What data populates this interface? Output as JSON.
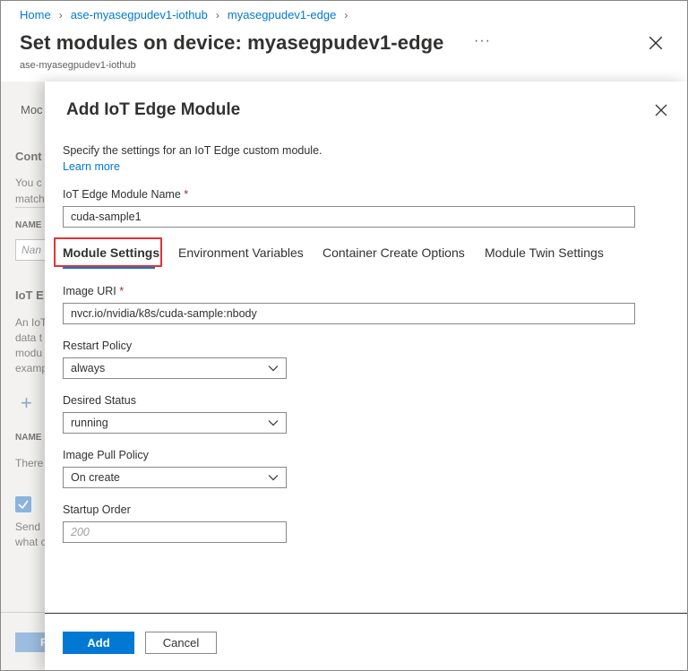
{
  "breadcrumb": {
    "items": [
      "Home",
      "ase-myasegpudev1-iothub",
      "myasegpudev1-edge"
    ]
  },
  "page": {
    "title": "Set modules on device: myasegpudev1-edge",
    "subtitle": "ase-myasegpudev1-iothub",
    "more": "···"
  },
  "background_blade": {
    "tab": "Moc",
    "section1": "Cont",
    "line1": "You c",
    "line2": "match",
    "name_header": "NAME",
    "name_placeholder": "Nan",
    "section2": "IoT E",
    "desc1": "An IoT",
    "desc2": "data t",
    "desc3": "modu",
    "desc4": "examp",
    "plus": "+",
    "name_header2": "NAME",
    "there": "There",
    "send1": "Send",
    "send2": "what c",
    "btn": "R"
  },
  "panel": {
    "title": "Add IoT Edge Module",
    "intro": "Specify the settings for an IoT Edge custom module.",
    "learn_more": "Learn more",
    "module_name_label": "IoT Edge Module Name",
    "module_name_value": "cuda-sample1",
    "required_mark": "*",
    "tabs": [
      {
        "label": "Module Settings",
        "active": true
      },
      {
        "label": "Environment Variables",
        "active": false
      },
      {
        "label": "Container Create Options",
        "active": false
      },
      {
        "label": "Module Twin Settings",
        "active": false
      }
    ],
    "image_uri_label": "Image URI",
    "image_uri_value": "nvcr.io/nvidia/k8s/cuda-sample:nbody",
    "restart_policy_label": "Restart Policy",
    "restart_policy_value": "always",
    "desired_status_label": "Desired Status",
    "desired_status_value": "running",
    "image_pull_policy_label": "Image Pull Policy",
    "image_pull_policy_value": "On create",
    "startup_order_label": "Startup Order",
    "startup_order_placeholder": "200",
    "add_button": "Add",
    "cancel_button": "Cancel"
  },
  "colors": {
    "accent": "#0078d4",
    "highlight": "#e33232",
    "required": "#a4262c"
  }
}
